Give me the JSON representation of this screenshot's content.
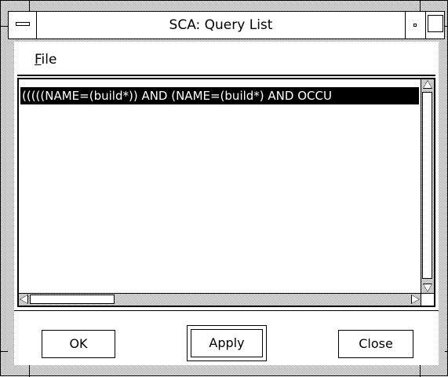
{
  "window": {
    "title": "SCA: Query List"
  },
  "menubar": {
    "file_label": "File",
    "file_mnemonic": "F",
    "file_rest": "ile"
  },
  "list": {
    "items": [
      "(((((NAME=(build*)) AND (NAME=(build*) AND OCCU"
    ],
    "selected_index": 0
  },
  "buttons": {
    "ok": "OK",
    "apply": "Apply",
    "close": "Close",
    "default": "apply"
  },
  "icons": {
    "window_menu": "window-menu-icon",
    "minimize": "minimize-icon",
    "maximize": "maximize-icon"
  }
}
